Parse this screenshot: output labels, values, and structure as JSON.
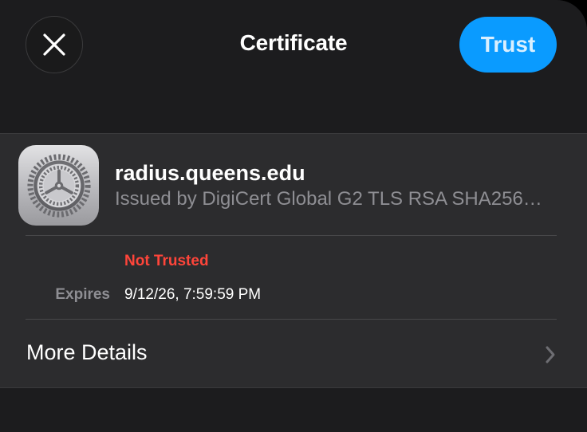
{
  "nav": {
    "title": "Certificate",
    "trust_label": "Trust",
    "close_icon": "close-icon"
  },
  "certificate": {
    "icon": "settings-gear-icon",
    "name": "radius.queens.edu",
    "issuer": "Issued by DigiCert Global G2 TLS RSA SHA256…",
    "status": "Not Trusted",
    "expires_label": "Expires",
    "expires_value": "9/12/26, 7:59:59 PM"
  },
  "more_details": {
    "label": "More Details",
    "icon": "chevron-right-icon"
  },
  "colors": {
    "accent": "#0a9bff",
    "danger": "#ff453a",
    "background": "#1c1c1e",
    "card": "#2c2c2e",
    "secondary_text": "#8e8e93"
  }
}
